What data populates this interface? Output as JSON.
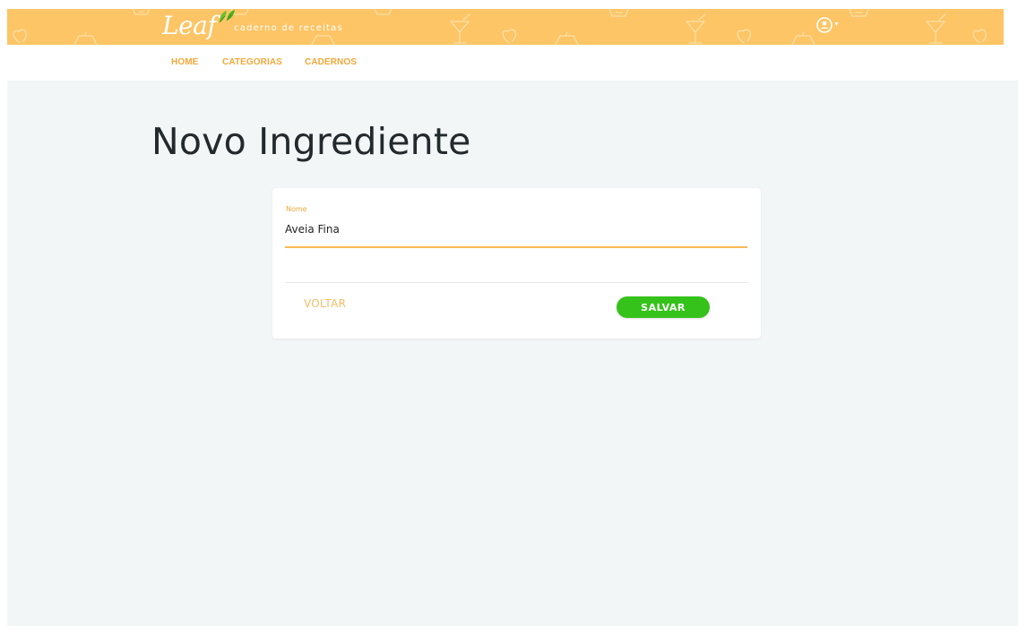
{
  "brand": {
    "logo_text": "Leaf",
    "tagline": "caderno de receitas"
  },
  "nav": {
    "items": [
      {
        "label": "HOME"
      },
      {
        "label": "CATEGORIAS"
      },
      {
        "label": "CADERNOS"
      }
    ]
  },
  "page": {
    "title": "Novo Ingrediente"
  },
  "form": {
    "name_label": "Nome",
    "name_value": "Aveia Fina",
    "back_label": "VOLTAR",
    "save_label": "SALVAR"
  },
  "colors": {
    "banner": "#fdc566",
    "accent": "#f0a83a",
    "save_button": "#35c21a",
    "background": "#f3f6f7"
  },
  "icons": {
    "user": "user-circle-icon",
    "caret": "caret-down-icon",
    "leaf": "leaf-icon"
  }
}
